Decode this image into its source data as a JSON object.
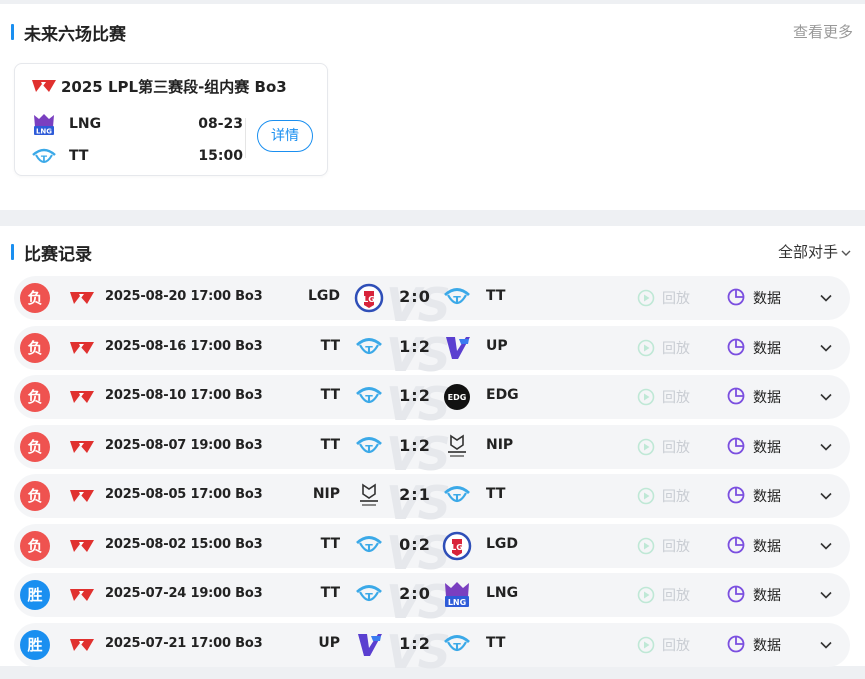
{
  "upcoming": {
    "title": "未来六场比赛",
    "more_label": "查看更多",
    "match": {
      "title": "2025 LPL第三赛段-组内赛 Bo3",
      "team1": {
        "name": "LNG",
        "date": "08-23"
      },
      "team2": {
        "name": "TT",
        "time": "15:00"
      },
      "detail_label": "详情"
    }
  },
  "records": {
    "title": "比赛记录",
    "filter_label": "全部对手",
    "replay_label": "回放",
    "data_label": "数据",
    "rows": [
      {
        "result": "负",
        "win": false,
        "datetime": "2025-08-20 17:00 Bo3",
        "left": "LGD",
        "left_logo": "lgd-logo-icon",
        "score": "2:0",
        "right": "TT",
        "right_logo": "tt-logo-icon"
      },
      {
        "result": "负",
        "win": false,
        "datetime": "2025-08-16 17:00 Bo3",
        "left": "TT",
        "left_logo": "tt-logo-icon",
        "score": "1:2",
        "right": "UP",
        "right_logo": "up-logo-icon"
      },
      {
        "result": "负",
        "win": false,
        "datetime": "2025-08-10 17:00 Bo3",
        "left": "TT",
        "left_logo": "tt-logo-icon",
        "score": "1:2",
        "right": "EDG",
        "right_logo": "edg-logo-icon"
      },
      {
        "result": "负",
        "win": false,
        "datetime": "2025-08-07 19:00 Bo3",
        "left": "TT",
        "left_logo": "tt-logo-icon",
        "score": "1:2",
        "right": "NIP",
        "right_logo": "nip-logo-icon"
      },
      {
        "result": "负",
        "win": false,
        "datetime": "2025-08-05 17:00 Bo3",
        "left": "NIP",
        "left_logo": "nip-logo-icon",
        "score": "2:1",
        "right": "TT",
        "right_logo": "tt-logo-icon"
      },
      {
        "result": "负",
        "win": false,
        "datetime": "2025-08-02 15:00 Bo3",
        "left": "TT",
        "left_logo": "tt-logo-icon",
        "score": "0:2",
        "right": "LGD",
        "right_logo": "lgd-logo-icon"
      },
      {
        "result": "胜",
        "win": true,
        "datetime": "2025-07-24 19:00 Bo3",
        "left": "TT",
        "left_logo": "tt-logo-icon",
        "score": "2:0",
        "right": "LNG",
        "right_logo": "lng-logo-icon"
      },
      {
        "result": "胜",
        "win": true,
        "datetime": "2025-07-21 17:00 Bo3",
        "left": "UP",
        "left_logo": "up-logo-icon",
        "score": "1:2",
        "right": "TT",
        "right_logo": "tt-logo-icon"
      }
    ]
  },
  "colors": {
    "accent": "#1a8ff0",
    "loss": "#ef5350",
    "win": "#1a8ff0",
    "data_icon": "#7b4fe0",
    "replay_icon": "#bfe8d6"
  }
}
